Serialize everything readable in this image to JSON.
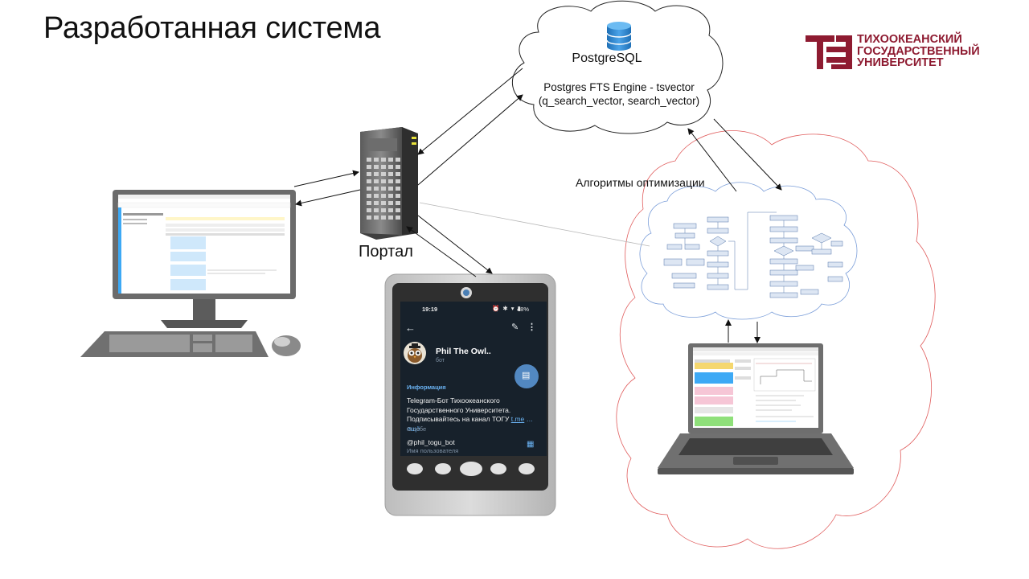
{
  "slide": {
    "title": "Разработанная система"
  },
  "logo": {
    "line1": "ТИХООКЕАНСКИЙ",
    "line2": "ГОСУДАРСТВЕННЫЙ",
    "line3": "УНИВЕРСИТЕТ",
    "brand_color": "#8e1b31"
  },
  "database": {
    "name": "PostgreSQL",
    "engine": "Postgres FTS Engine - tsvector",
    "fields": "(q_search_vector, search_vector)",
    "icon": "database-icon"
  },
  "algorithms": {
    "label": "Алгоритмы оптимизации"
  },
  "portal": {
    "label": "Портал",
    "icon": "server-icon"
  },
  "phone": {
    "status_time": "19:19",
    "status_battery": "48%",
    "bot_name": "Phil The Owl..",
    "bot_type": "бот",
    "info_heading": "Информация",
    "about_text": "Telegram-Бот Тихоокеанского Государственного Университета. Подписывайтесь на канал ТОГУ ",
    "about_link": "t.me",
    "about_more": "…ещё",
    "about_caption": "О себе",
    "username": "@phil_togu_bot",
    "username_caption": "Имя пользователя"
  },
  "colors": {
    "accent_blue": "#3da9f5",
    "cloud_blue": "#7b9ed9",
    "cloud_red": "#e05c5c",
    "device_grey": "#8a8a8a"
  }
}
